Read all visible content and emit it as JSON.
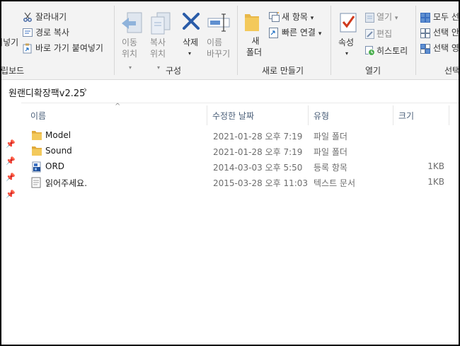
{
  "ribbon": {
    "clipboard": {
      "paste_partial": "붙여넣기",
      "cut": "잘라내기",
      "copy_path": "경로 복사",
      "paste_shortcut": "바로 가기 붙여넣기",
      "label": "클립보드"
    },
    "organize": {
      "move_to": [
        "이동",
        "위치"
      ],
      "copy_to": [
        "복사",
        "위치"
      ],
      "delete": "삭제",
      "rename": [
        "이름",
        "바꾸기"
      ],
      "label": "구성"
    },
    "new": {
      "new_folder": [
        "새",
        "폴더"
      ],
      "new_item": "새 항목",
      "easy_access": "빠른 연결",
      "label": "새로 만들기"
    },
    "open": {
      "properties": "속성",
      "open": "열기",
      "edit": "편집",
      "history": "히스토리",
      "label": "열기"
    },
    "select": {
      "select_all": "모두 선",
      "select_none": "선택 안",
      "invert": "선택 영",
      "label": "선택"
    }
  },
  "address": {
    "path": "원랜디확장팩v2.25",
    "chevron": "›"
  },
  "columns": {
    "name": "이름",
    "modified": "수정한 날짜",
    "type": "유형",
    "size": "크기"
  },
  "files": [
    {
      "name": "Model",
      "modified": "2021-01-28 오후 7:19",
      "type": "파일 폴더",
      "size": "",
      "icon": "folder-icon"
    },
    {
      "name": "Sound",
      "modified": "2021-01-28 오후 7:19",
      "type": "파일 폴더",
      "size": "",
      "icon": "folder-icon"
    },
    {
      "name": "ORD",
      "modified": "2014-03-03 오후 5:50",
      "type": "등록 항목",
      "size": "1KB",
      "icon": "registry-icon"
    },
    {
      "name": "읽어주세요.",
      "modified": "2015-03-28 오후 11:03",
      "type": "텍스트 문서",
      "size": "1KB",
      "icon": "text-document-icon"
    }
  ],
  "colors": {
    "ribbon_bg": "#f3f3f3",
    "folder": "#e8b84a",
    "accent": "#1e6fc4",
    "delete": "#2a5ca8"
  }
}
